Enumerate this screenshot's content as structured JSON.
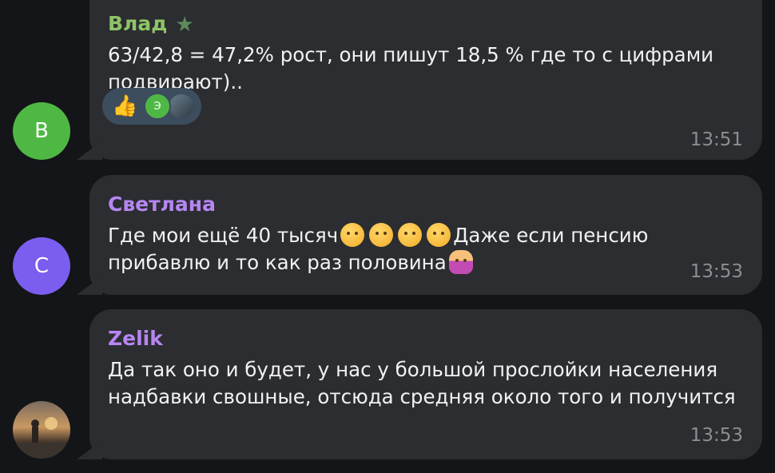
{
  "messages": [
    {
      "sender": "Влад",
      "sender_color": "#8fc466",
      "badge_icon": "star-icon",
      "avatar_letter": "В",
      "avatar_color": "#4fb844",
      "text": "63/42,8 = 47,2% рост, они пишут 18,5 % где то с цифрами подвирают)..",
      "time": "13:51",
      "reactions": {
        "emoji": "👍",
        "avatar_letter": "Э"
      }
    },
    {
      "sender": "Светлана",
      "sender_color": "#b786f2",
      "avatar_letter": "С",
      "avatar_color": "#7b5ef0",
      "text_part1": "Где мои ещё 40 тысяч",
      "text_part2": "Даже если пенсию прибавлю и то как раз половина",
      "emojis": [
        "face-with-hand-over-mouth-emoji",
        "thinking-face-emoji",
        "thinking-face-emoji",
        "thinking-face-emoji",
        "person-shrugging-emoji"
      ],
      "time": "13:53"
    },
    {
      "sender": "Zelik",
      "sender_color": "#b786f2",
      "avatar": "photo-avatar",
      "text": "Да так оно и будет, у нас у большой прослойки населения надбавки свошные, отсюда средняя около того и получится",
      "time": "13:53"
    }
  ]
}
